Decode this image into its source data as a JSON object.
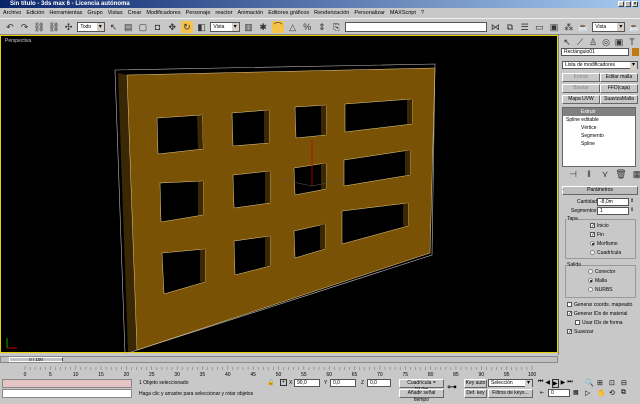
{
  "window": {
    "title": "Sin título - 3ds max 6 - Licencia autónoma",
    "controls": [
      "_",
      "□",
      "×"
    ]
  },
  "menu": [
    "Archivo",
    "Edición",
    "Herramientas",
    "Grupo",
    "Vistas",
    "Crear",
    "Modificadores",
    "Personaje",
    "reactor",
    "Animación",
    "Editores gráficos",
    "Renderización",
    "Personalizar",
    "MAXScript",
    "?"
  ],
  "toolbar": {
    "selection_filter": "Todo",
    "ref_coord": "Vista",
    "render_type": "Vista",
    "named_sel": ""
  },
  "viewport": {
    "label": "Perspectiva",
    "object_color": "#7a5206"
  },
  "panel": {
    "object_name": "Rectángulo01",
    "object_color": "#c07a10",
    "modifier_list": "Lista de modificadores",
    "buttons": [
      {
        "label": "Extruir",
        "enabled": false
      },
      {
        "label": "Editar malla",
        "enabled": true
      },
      {
        "label": "Biselar",
        "enabled": false
      },
      {
        "label": "FFD(caja)",
        "enabled": true
      },
      {
        "label": "Mapa UVW",
        "enabled": true
      },
      {
        "label": "SuavizaMalla",
        "enabled": true
      }
    ],
    "stack": [
      {
        "label": "Extruir",
        "selected": true
      },
      {
        "label": "Spline editable"
      },
      {
        "label": "Vértice"
      },
      {
        "label": "Segmento"
      },
      {
        "label": "Spline"
      }
    ],
    "rollout": "Parámetros",
    "cantidad_label": "Cantidad:",
    "cantidad": "-8,0m",
    "segmentos_label": "Segmentos:",
    "segmentos": "1",
    "tapa_label": "Tapa",
    "inicio": "Inicio",
    "fin": "Fin",
    "morfismo": "Morfismo",
    "cuadricula": "Cuadrícula",
    "salida_label": "Salida",
    "conector": "Conector",
    "malla": "Malla",
    "nurbs": "NURBS",
    "gen_coords": "Generar coords. mapeado",
    "gen_ids": "Generar IDs de material",
    "usar_ids": "Usar IDs de forma",
    "suavizar": "Suavizar"
  },
  "timeline": {
    "frame": "0 / 100",
    "ticks": [
      "0",
      "5",
      "10",
      "15",
      "20",
      "25",
      "30",
      "35",
      "40",
      "45",
      "50",
      "55",
      "60",
      "65",
      "70",
      "75",
      "80",
      "85",
      "90",
      "95",
      "100"
    ]
  },
  "status": {
    "selected": "1 Objeto seleccionado",
    "prompt": "Haga clic y arrastre para seleccionar y rotar objetos",
    "x_label": "X",
    "x": "90,0",
    "y_label": "Y",
    "y": "0,0",
    "z_label": "Z",
    "z": "0,0",
    "grid": "Cuadrícula = 10,0m",
    "add_time_tag": "Añadir señal tiempo",
    "key_auto": "Key auto",
    "def_key": "Def. key",
    "key_mode": "Selección",
    "key_filters": "Filtros de keys...",
    "current_frame": "0"
  }
}
